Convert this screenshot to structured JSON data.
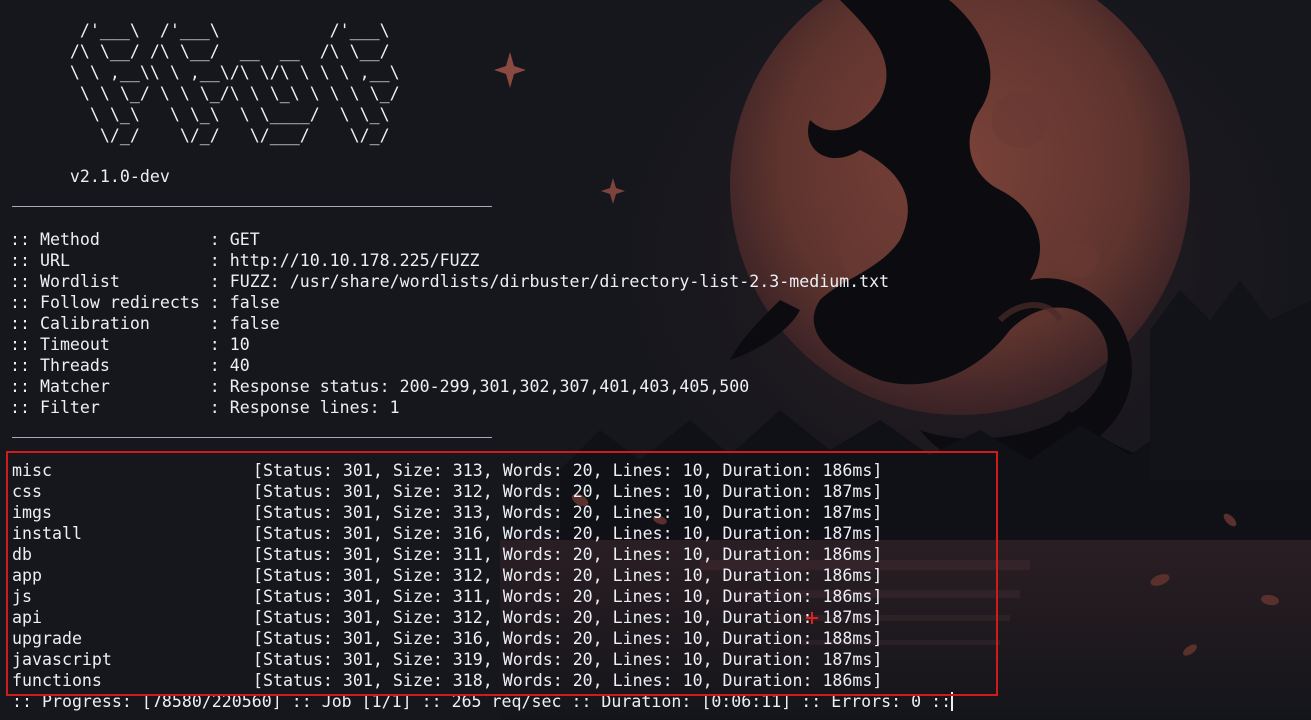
{
  "banner": {
    "art": [
      "        /'___\\  /'___\\           /'___\\",
      "       /\\ \\__/ /\\ \\__/  __  __  /\\ \\__/",
      "       \\ \\ ,__\\\\ \\ ,__\\/\\ \\/\\ \\ \\ \\ ,__\\",
      "        \\ \\ \\_/ \\ \\ \\_/\\ \\ \\_\\ \\ \\ \\ \\_/",
      "         \\ \\_\\   \\ \\_\\  \\ \\____/  \\ \\_\\",
      "          \\/_/    \\/_/   \\/___/    \\/_/"
    ],
    "version": "       v2.1.0-dev"
  },
  "config": [
    {
      "label": " :: Method           : ",
      "value": "GET"
    },
    {
      "label": " :: URL              : ",
      "value": "http://10.10.178.225/FUZZ"
    },
    {
      "label": " :: Wordlist         : ",
      "value": "FUZZ: /usr/share/wordlists/dirbuster/directory-list-2.3-medium.txt"
    },
    {
      "label": " :: Follow redirects : ",
      "value": "false"
    },
    {
      "label": " :: Calibration      : ",
      "value": "false"
    },
    {
      "label": " :: Timeout          : ",
      "value": "10"
    },
    {
      "label": " :: Threads          : ",
      "value": "40"
    },
    {
      "label": " :: Matcher          : ",
      "value": "Response status: 200-299,301,302,307,401,403,405,500"
    },
    {
      "label": " :: Filter           : ",
      "value": "Response lines: 1"
    }
  ],
  "results": [
    {
      "path": "misc",
      "info": "[Status: 301, Size: 313, Words: 20, Lines: 10, Duration: 186ms]"
    },
    {
      "path": "css",
      "info": "[Status: 301, Size: 312, Words: 20, Lines: 10, Duration: 187ms]"
    },
    {
      "path": "imgs",
      "info": "[Status: 301, Size: 313, Words: 20, Lines: 10, Duration: 187ms]"
    },
    {
      "path": "install",
      "info": "[Status: 301, Size: 316, Words: 20, Lines: 10, Duration: 187ms]"
    },
    {
      "path": "db",
      "info": "[Status: 301, Size: 311, Words: 20, Lines: 10, Duration: 186ms]"
    },
    {
      "path": "app",
      "info": "[Status: 301, Size: 312, Words: 20, Lines: 10, Duration: 186ms]"
    },
    {
      "path": "js",
      "info": "[Status: 301, Size: 311, Words: 20, Lines: 10, Duration: 186ms]"
    },
    {
      "path": "api",
      "info": "[Status: 301, Size: 312, Words: 20, Lines: 10, Duration: 187ms]"
    },
    {
      "path": "upgrade",
      "info": "[Status: 301, Size: 316, Words: 20, Lines: 10, Duration: 188ms]"
    },
    {
      "path": "javascript",
      "info": "[Status: 301, Size: 319, Words: 20, Lines: 10, Duration: 187ms]"
    },
    {
      "path": "functions",
      "info": "[Status: 301, Size: 318, Words: 20, Lines: 10, Duration: 186ms]"
    }
  ],
  "progress_line": ":: Progress: [78580/220560] :: Job [1/1] :: 265 req/sec :: Duration: [0:06:11] :: Errors: 0 ::",
  "colors": {
    "background": "#16171d",
    "text": "#eceff4",
    "highlight_border": "#d11a1a",
    "moon": "#6b3a33",
    "dragon": "#0c0c10"
  },
  "icons": {
    "mouse_cursor": "crosshair-cursor-icon"
  }
}
